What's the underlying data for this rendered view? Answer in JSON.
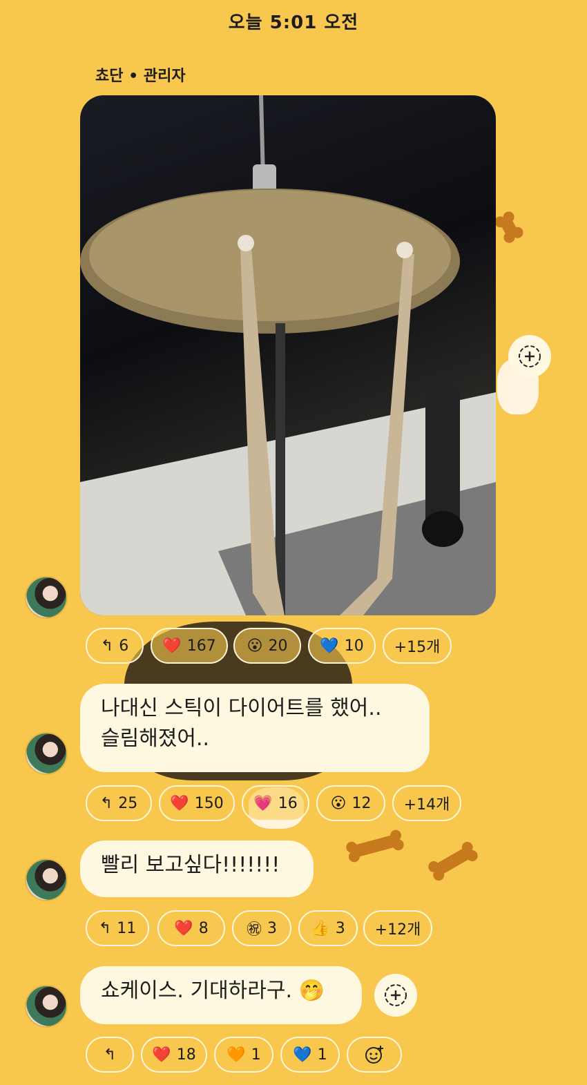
{
  "header": {
    "time": "오늘 5:01 오전"
  },
  "sender": {
    "name": "쵸단 • 관리자"
  },
  "colors": {
    "background": "#F8C84E",
    "bubble": "#FFF8E1"
  },
  "messages": [
    {
      "type": "image",
      "reactions": [
        {
          "icon": "reply-icon",
          "emoji": "↰",
          "count": "6"
        },
        {
          "icon": "heart-icon",
          "emoji": "❤️",
          "count": "167"
        },
        {
          "icon": "surprised-icon",
          "emoji": "😮",
          "count": "20"
        },
        {
          "icon": "blue-heart-icon",
          "emoji": "💙",
          "count": "10"
        }
      ],
      "more": "+15개"
    },
    {
      "type": "text",
      "text_line1": "나대신 스틱이 다이어트를 했어..",
      "text_line2": "슬림해졌어..",
      "reactions": [
        {
          "icon": "reply-icon",
          "emoji": "↰",
          "count": "25"
        },
        {
          "icon": "heart-icon",
          "emoji": "❤️",
          "count": "150"
        },
        {
          "icon": "pink-heart-icon",
          "emoji": "💗",
          "count": "16"
        },
        {
          "icon": "surprised-icon",
          "emoji": "😮",
          "count": "12"
        }
      ],
      "more": "+14개"
    },
    {
      "type": "text",
      "text_line1": "빨리 보고싶다!!!!!!!",
      "reactions": [
        {
          "icon": "reply-icon",
          "emoji": "↰",
          "count": "11"
        },
        {
          "icon": "heart-icon",
          "emoji": "❤️",
          "count": "8"
        },
        {
          "icon": "celebrate-icon",
          "emoji": "㊗",
          "count": "3"
        },
        {
          "icon": "thumbs-up-icon",
          "emoji": "👍",
          "count": "3"
        }
      ],
      "more": "+12개"
    },
    {
      "type": "text",
      "text_line1": "쇼케이스. 기대하라구. 🤭",
      "reactions": [
        {
          "icon": "reply-icon",
          "emoji": "↰",
          "count": ""
        },
        {
          "icon": "heart-icon",
          "emoji": "❤️",
          "count": "18"
        },
        {
          "icon": "brown-heart-icon",
          "emoji": "🧡",
          "count": "1"
        },
        {
          "icon": "blue-heart-icon",
          "emoji": "💙",
          "count": "1"
        }
      ],
      "add_reaction_icon": "add-emoji-icon"
    }
  ]
}
